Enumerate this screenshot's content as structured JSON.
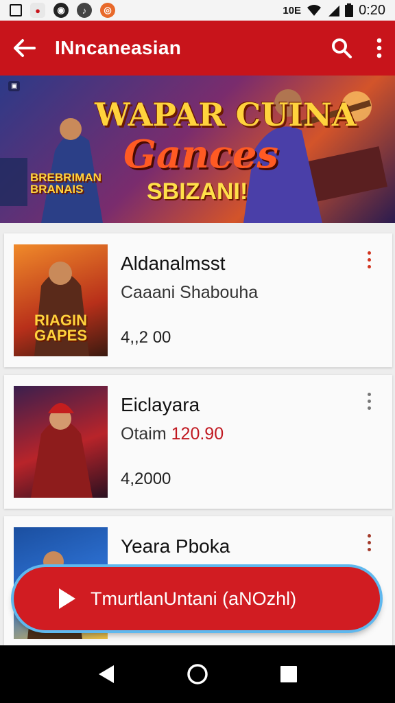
{
  "status_bar": {
    "time": "0:20",
    "indicator_text": "10E"
  },
  "app_bar": {
    "title": "INncaneasian"
  },
  "banner": {
    "line1": "WAPAR CUINA",
    "line2": "Gances",
    "line3": "SBIZANI!",
    "sub_line1": "BREBRIMAN",
    "sub_line2": "BRANAIS"
  },
  "cards": [
    {
      "title": "Aldanalmsst",
      "subtitle": "Caaani Shabouha",
      "price": "",
      "number": "4,,2 00",
      "thumb_text": "RIAGIN GAPES",
      "thumb_colors": [
        "#b8301a",
        "#f08a2a"
      ],
      "menu_color": "#d1341f"
    },
    {
      "title": "Eiclayara",
      "subtitle": "Otaim",
      "price": "120.90",
      "number": "4,2000",
      "thumb_text": "",
      "thumb_colors": [
        "#3a1f4e",
        "#b8242a"
      ],
      "menu_color": "#777777"
    },
    {
      "title": "Yeara Pboka",
      "subtitle": "",
      "price": "",
      "number": "",
      "thumb_text": "",
      "thumb_colors": [
        "#1b4fa0",
        "#f0c040"
      ],
      "menu_color": "#a33a2a"
    }
  ],
  "cta": {
    "label": "TmurtlanUntani (aNOzhl)"
  },
  "colors": {
    "primary": "#c8141b",
    "cta_border": "#5fb8ee"
  },
  "icons": {
    "back": "back-arrow-icon",
    "search": "search-icon",
    "more": "more-vert-icon",
    "play": "play-icon",
    "nav_back": "nav-back-icon",
    "nav_home": "nav-home-icon",
    "nav_recents": "nav-recents-icon"
  }
}
